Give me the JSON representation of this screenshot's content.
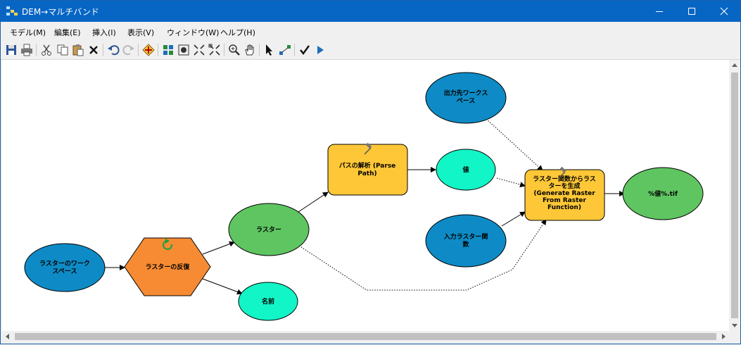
{
  "window": {
    "title": "DEM→マルチバンド"
  },
  "menu": [
    "モデル(M)",
    "編集(E)",
    "挿入(I)",
    "表示(V)",
    "ウィンドウ(W)",
    "ヘルプ(H)"
  ],
  "toolbar": [
    "save-icon",
    "print-icon",
    "cut-icon",
    "copy-icon",
    "paste-icon",
    "delete-icon",
    "undo-icon",
    "redo-icon",
    "add-data-icon",
    "auto-layout-icon",
    "full-extent-icon",
    "zoom-in-fixed-icon",
    "zoom-out-fixed-icon",
    "zoom-in-icon",
    "pan-icon",
    "select-icon",
    "connect-icon",
    "validate-icon",
    "run-icon"
  ],
  "colors": {
    "titlebar": "#0766c4",
    "input_data": "#0e8bc6",
    "tool": "#fec737",
    "iterator": "#f68b33",
    "output": "#5fc561",
    "value": "#12f5c7"
  },
  "model": {
    "nodes": [
      {
        "id": "raster_workspace",
        "kind": "input-variable",
        "lines": [
          "ラスターのワーク",
          "スペース"
        ]
      },
      {
        "id": "iterate_rasters",
        "kind": "iterator",
        "lines": [
          "ラスターの反復"
        ]
      },
      {
        "id": "raster",
        "kind": "derived-variable",
        "lines": [
          "ラスター"
        ]
      },
      {
        "id": "name",
        "kind": "value",
        "lines": [
          "名前"
        ]
      },
      {
        "id": "parse_path",
        "kind": "tool",
        "lines": [
          "パスの解析 (Parse",
          "Path)"
        ]
      },
      {
        "id": "value",
        "kind": "value",
        "lines": [
          "値"
        ]
      },
      {
        "id": "output_workspace",
        "kind": "input-variable",
        "lines": [
          "出力先ワークス",
          "ペース"
        ]
      },
      {
        "id": "input_raster_function",
        "kind": "input-variable",
        "lines": [
          "入力ラスター関",
          "数"
        ]
      },
      {
        "id": "generate_raster",
        "kind": "tool",
        "lines": [
          "ラスター関数からラス",
          "ターを生成",
          "(Generate Raster",
          "From Raster",
          "Function)"
        ]
      },
      {
        "id": "output_tif",
        "kind": "output",
        "lines": [
          "%値%.tif"
        ]
      }
    ],
    "connections": [
      {
        "from": "raster_workspace",
        "to": "iterate_rasters",
        "style": "solid"
      },
      {
        "from": "iterate_rasters",
        "to": "raster",
        "style": "solid"
      },
      {
        "from": "iterate_rasters",
        "to": "name",
        "style": "solid"
      },
      {
        "from": "raster",
        "to": "parse_path",
        "style": "solid"
      },
      {
        "from": "parse_path",
        "to": "value",
        "style": "solid"
      },
      {
        "from": "value",
        "to": "generate_raster",
        "style": "dotted"
      },
      {
        "from": "output_workspace",
        "to": "generate_raster",
        "style": "dotted"
      },
      {
        "from": "input_raster_function",
        "to": "generate_raster",
        "style": "solid"
      },
      {
        "from": "raster",
        "to": "generate_raster",
        "style": "dotted"
      },
      {
        "from": "generate_raster",
        "to": "output_tif",
        "style": "solid"
      }
    ]
  }
}
